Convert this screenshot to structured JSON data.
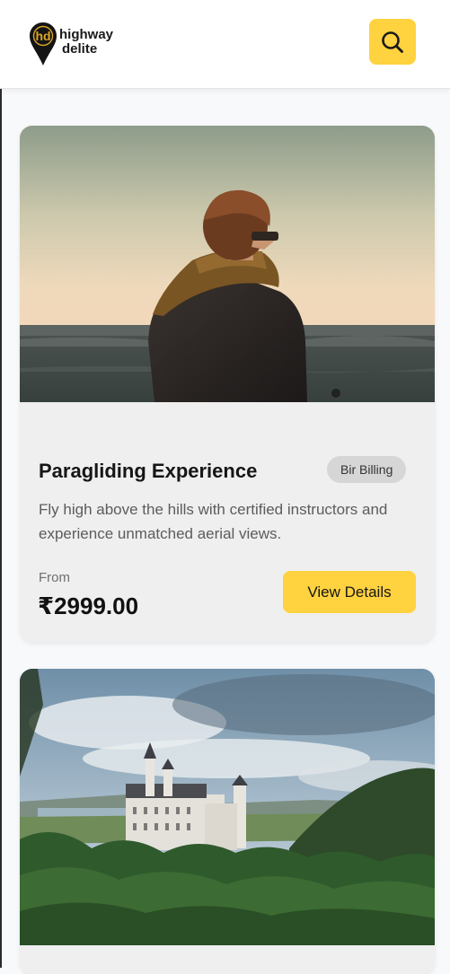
{
  "header": {
    "logo_initials": "hd",
    "logo_line1": "highway",
    "logo_line2": "delite",
    "search_icon": "search-icon"
  },
  "colors": {
    "accent": "#ffd23f",
    "card_bg": "#efefef",
    "badge_bg": "#d6d6d6"
  },
  "experiences": [
    {
      "title": "Paragliding Experience",
      "location": "Bir Billing",
      "description": "Fly high above the hills with certified instructors and experience unmatched aerial views.",
      "price_prefix": "From",
      "price": "₹2999.00",
      "cta_label": "View Details",
      "image_icon": "person-by-lake-photo"
    },
    {
      "image_icon": "castle-forest-photo"
    }
  ]
}
